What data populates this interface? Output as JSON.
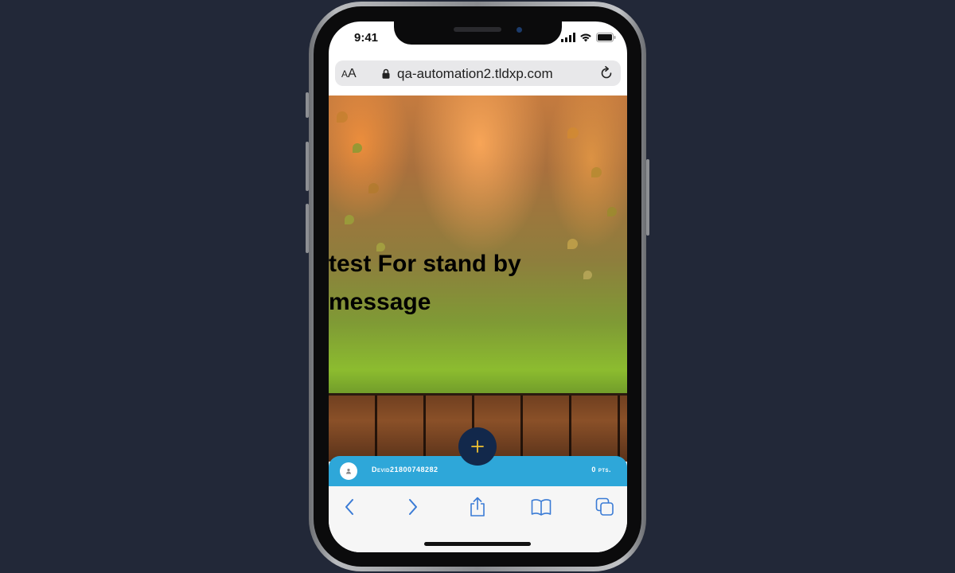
{
  "status_bar": {
    "time": "9:41"
  },
  "browser": {
    "text_size_label_small": "A",
    "text_size_label_large": "A",
    "url": "qa-automation2.tldxp.com"
  },
  "page": {
    "message": "test For stand by message"
  },
  "user_bar": {
    "username": "Devid21800748282",
    "points": "0 pts."
  },
  "colors": {
    "background": "#222838",
    "user_bar": "#2ea7d9",
    "fab": "#12284b",
    "fab_plus": "#f2c230",
    "toolbar_icons": "#3a7bd5"
  },
  "icons": [
    "lock-icon",
    "reload-icon",
    "signal-icon",
    "wifi-icon",
    "battery-icon",
    "plus-icon",
    "user-icon",
    "back-icon",
    "forward-icon",
    "share-icon",
    "bookmarks-icon",
    "tabs-icon"
  ]
}
